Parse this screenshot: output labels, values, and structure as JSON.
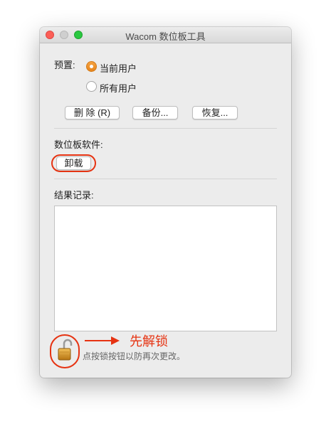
{
  "window": {
    "title": "Wacom 数位板工具"
  },
  "preset": {
    "label": "预置:",
    "options": [
      {
        "label": "当前用户",
        "selected": true
      },
      {
        "label": "所有用户",
        "selected": false
      }
    ]
  },
  "buttons": {
    "delete": "删 除 (R)",
    "backup": "备份...",
    "restore": "恢复..."
  },
  "software": {
    "label": "数位板软件:",
    "uninstall": "卸载"
  },
  "log": {
    "label": "结果记录:",
    "content": ""
  },
  "lock": {
    "icon": "lock-icon",
    "state": "unlocked",
    "hint": "点按锁按钮以防再次更改。"
  },
  "annotation": {
    "text": "先解锁",
    "color": "#e63312"
  },
  "colors": {
    "accent_radio": "#e8851c",
    "annotation_red": "#e63312"
  }
}
